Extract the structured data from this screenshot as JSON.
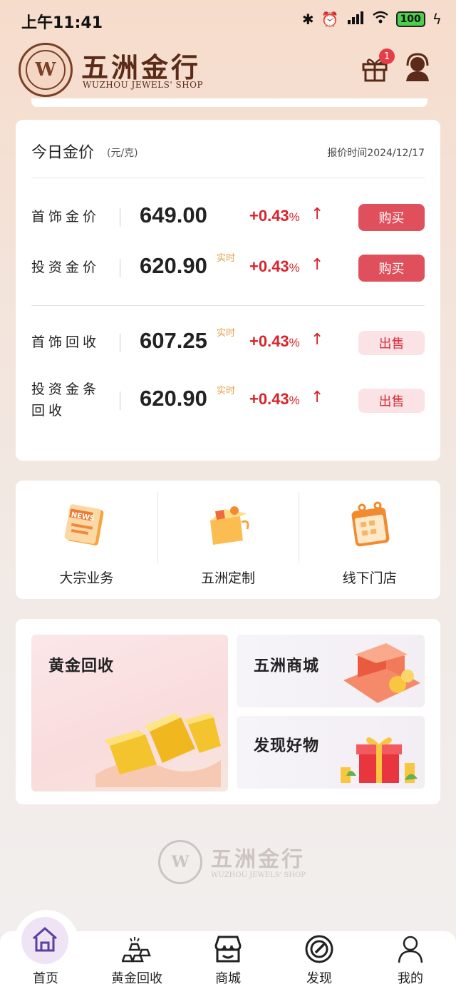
{
  "status_bar": {
    "time": "上午11:41",
    "battery": "100"
  },
  "header": {
    "logo_cn": "五洲金行",
    "logo_en": "WUZHOU JEWELS' SHOP",
    "gift_badge": "1"
  },
  "price_card": {
    "title": "今日金价",
    "unit": "(元/克)",
    "quote_time": "报价时间2024/12/17",
    "rows": [
      {
        "label": "首饰金价",
        "price": "649.00",
        "tag": "",
        "change": "+0.43",
        "pct": "%",
        "action": "购买",
        "action_type": "buy"
      },
      {
        "label": "投资金价",
        "price": "620.90",
        "tag": "实时",
        "change": "+0.43",
        "pct": "%",
        "action": "购买",
        "action_type": "buy"
      },
      {
        "label": "首饰回收",
        "price": "607.25",
        "tag": "实时",
        "change": "+0.43",
        "pct": "%",
        "action": "出售",
        "action_type": "sell"
      },
      {
        "label": "投资金条 回收",
        "price": "620.90",
        "tag": "实时",
        "change": "+0.43",
        "pct": "%",
        "action": "出售",
        "action_type": "sell"
      }
    ]
  },
  "services": [
    {
      "label": "大宗业务",
      "icon": "news-scroll-icon"
    },
    {
      "label": "五洲定制",
      "icon": "gift-box-icon"
    },
    {
      "label": "线下门店",
      "icon": "calendar-icon"
    }
  ],
  "features": {
    "big": {
      "title": "黄金回收"
    },
    "small": [
      {
        "title": "五洲商城"
      },
      {
        "title": "发现好物"
      }
    ]
  },
  "footer": {
    "logo_cn": "五洲金行",
    "logo_en": "WUZHOU JEWELS' SHOP"
  },
  "nav": [
    {
      "label": "首页",
      "icon": "home-icon",
      "active": true
    },
    {
      "label": "黄金回收",
      "icon": "gold-bars-icon",
      "active": false
    },
    {
      "label": "商城",
      "icon": "shop-icon",
      "active": false
    },
    {
      "label": "发现",
      "icon": "discover-icon",
      "active": false
    },
    {
      "label": "我的",
      "icon": "user-icon",
      "active": false
    }
  ],
  "colors": {
    "accent_red": "#d8232a",
    "buy_button": "#e0505c",
    "sell_button_bg": "#fbe3e5",
    "brand_brown": "#5b2a18"
  }
}
